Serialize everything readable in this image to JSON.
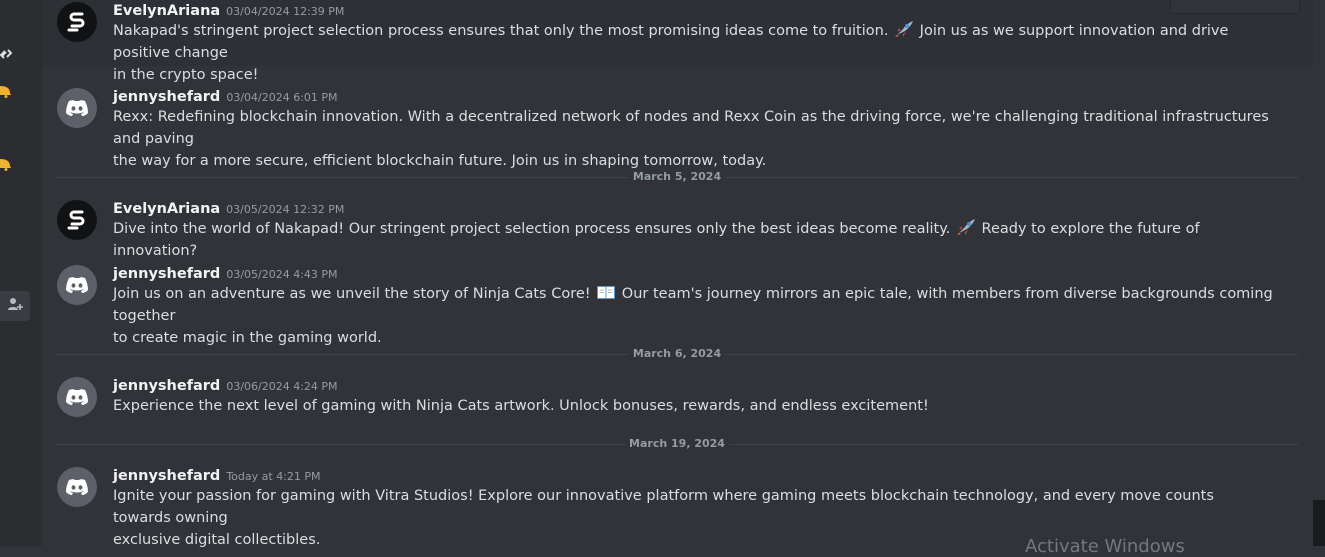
{
  "messages": [
    {
      "author": "EvelynAriana",
      "timestamp": "03/04/2024 12:39 PM",
      "avatar": "nakapad-logo",
      "lines": [
        {
          "text": "Nakapad's stringent project selection process ensures that only the most promising ideas come to fruition. ",
          "emoji": "rocket-emoji",
          "after": " Join us as we support innovation and drive positive change"
        },
        {
          "text": "in the crypto space!"
        }
      ]
    },
    {
      "author": "jennyshefard",
      "timestamp": "03/04/2024 6:01 PM",
      "avatar": "discord-logo",
      "lines": [
        {
          "text": "Rexx: Redefining blockchain innovation. With a decentralized network of nodes and Rexx Coin as the driving force, we're challenging traditional infrastructures and paving"
        },
        {
          "text": "the way for a more secure, efficient blockchain future. Join us in shaping tomorrow, today."
        }
      ]
    },
    {
      "author": "EvelynAriana",
      "timestamp": "03/05/2024 12:32 PM",
      "avatar": "nakapad-logo",
      "lines": [
        {
          "text": "Dive into the world of Nakapad! Our stringent project selection process ensures only the best ideas become reality. ",
          "emoji": "rocket-emoji",
          "after": " Ready to explore the future of innovation?"
        }
      ]
    },
    {
      "author": "jennyshefard",
      "timestamp": "03/05/2024 4:43 PM",
      "avatar": "discord-logo",
      "lines": [
        {
          "text": "Join us on an adventure as we unveil the story of Ninja Cats Core! ",
          "emoji": "open-book-emoji",
          "after": " Our team's journey mirrors an epic tale, with members from diverse backgrounds coming together"
        },
        {
          "text": "to create magic in the gaming world."
        }
      ]
    },
    {
      "author": "jennyshefard",
      "timestamp": "03/06/2024 4:24 PM",
      "avatar": "discord-logo",
      "lines": [
        {
          "text": "Experience the next level of gaming with Ninja Cats artwork. Unlock bonuses, rewards, and endless excitement!"
        }
      ]
    },
    {
      "author": "jennyshefard",
      "timestamp": "Today at 4:21 PM",
      "avatar": "discord-logo",
      "lines": [
        {
          "text": "Ignite your passion for gaming with Vitra Studios! Explore our innovative platform where gaming meets blockchain technology, and every move counts towards owning"
        },
        {
          "text": "exclusive digital collectibles."
        }
      ]
    }
  ],
  "dividers": [
    {
      "label": "March 5, 2024"
    },
    {
      "label": "March 6, 2024"
    },
    {
      "label": "March 19, 2024"
    }
  ],
  "watermark": "Activate Windows",
  "colors": {
    "background": "#313338",
    "sidebar": "#2b2d31",
    "author": "#f2f3f5",
    "timestamp": "#949ba4",
    "message_text": "#dbdee1",
    "bell_icon": "#f0b232"
  },
  "icons": [
    "link-icon",
    "bell-icon",
    "bell-icon",
    "add-member-icon",
    "rocket-emoji",
    "open-book-emoji"
  ]
}
